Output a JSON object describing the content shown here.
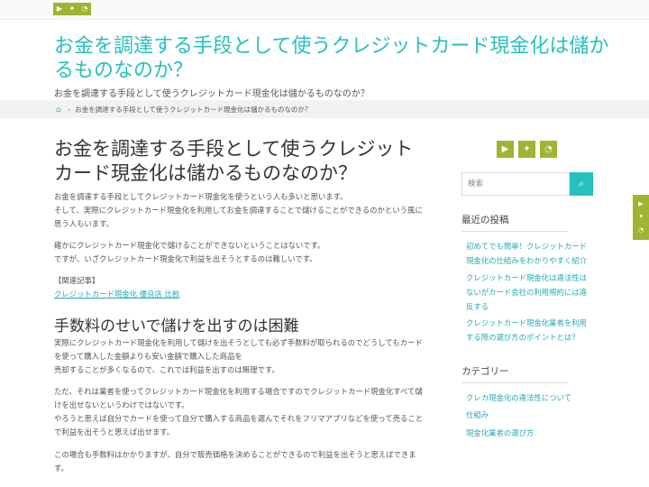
{
  "header": {
    "site_title": "お金を調達する手段として使うクレジットカード現金化は儲かるものなのか？",
    "site_description": "お金を調達する手段として使うクレジットカード現金化は儲かるものなのか？",
    "social_icons": [
      "youtube-icon",
      "twitter-icon",
      "rss-icon"
    ]
  },
  "breadcrumb": {
    "home_icon": "home-icon",
    "current": "お金を調達する手段として使うクレジットカード現金化は儲かるものなのか？"
  },
  "article": {
    "title": "お金を調達する手段として使うクレジットカード現金化は儲かるものなのか？",
    "p1": "お金を調達する手段としてクレジットカード現金化を使うという人も多いと思います。",
    "p1b": "そして、実際にクレジットカード現金化を利用してお金を調達することで儲けることができるのかという風に思う人もいます。",
    "p2": "確かにクレジットカード現金化で儲けることができないということはないです。",
    "p2b": "ですが、いざクレジットカード現金化で利益を出そうとするのは難しいです。",
    "related_label": "【関連記事】",
    "related_link": "クレジットカード現金化 優良店 比較",
    "h2": "手数料のせいで儲けを出すのは困難",
    "p3": "実際にクレジットカード現金化を利用して儲けを出そうとしても必ず手数料が取られるのでどうしてもカードを使って購入した金額よりも安い金額で購入した商品を",
    "p3b": "売却することが多くなるので、これでは利益を出すのは無理です。",
    "p4": "ただ、それは業者を使ってクレジットカード現金化を利用する場合ですのでクレジットカード現金化すべて儲けを出せないというわけではないです。",
    "p4b": "やろうと思えば自分でカードを使って自分で購入する商品を選んでそれをフリマアプリなどを使って売ることで利益を出そうと思えば出せます。",
    "p5": "この場合も手数料はかかりますが、自分で販売価格を決めることができるので利益を出そうと思えばできます。"
  },
  "sidebar": {
    "search_placeholder": "検索",
    "search_icon": "search-icon",
    "recent_title": "最近の投稿",
    "recent_posts": [
      "初めてでも簡単！クレジットカード現金化の仕組みをわかりやすく紹介",
      "クレジットカード現金化は違法性はないがカード会社の利用規約には違反する",
      "クレジットカード現金化業者を利用する際の選び方のポイントとは？"
    ],
    "category_title": "カテゴリー",
    "categories": [
      "クレカ現金化の違法性について",
      "仕組み",
      "現金化業者の選び方"
    ]
  },
  "colors": {
    "accent": "#26c0be",
    "social": "#9fb531",
    "link": "#26a9b8"
  }
}
